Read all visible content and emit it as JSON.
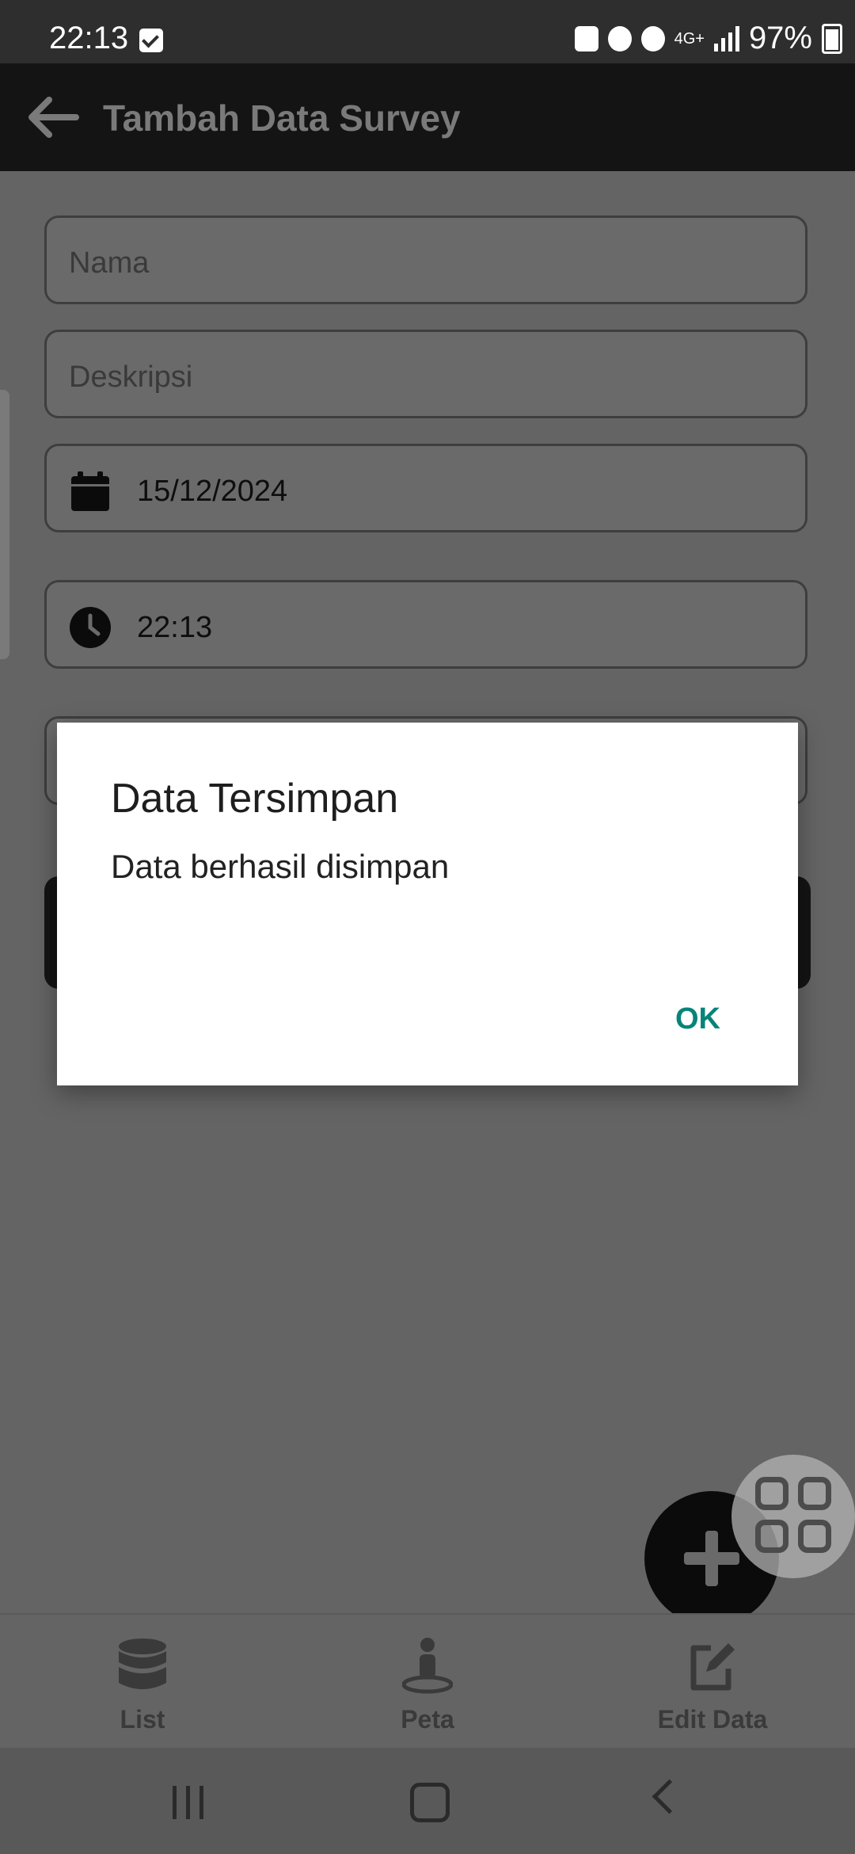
{
  "status_bar": {
    "time": "22:13",
    "network": "4G+",
    "battery": "97%"
  },
  "app_bar": {
    "title": "Tambah Data Survey"
  },
  "form": {
    "nama_placeholder": "Nama",
    "deskripsi_placeholder": "Deskripsi",
    "date_value": "15/12/2024",
    "time_value": "22:13"
  },
  "dialog": {
    "title": "Data Tersimpan",
    "message": "Data berhasil disimpan",
    "ok_label": "OK"
  },
  "bottom_nav": {
    "items": [
      {
        "label": "List",
        "icon": "database-icon"
      },
      {
        "label": "Peta",
        "icon": "person-pin-icon"
      },
      {
        "label": "Edit Data",
        "icon": "edit-icon"
      }
    ]
  },
  "colors": {
    "accent": "#06847a",
    "scrim": "#646464",
    "appbar": "#141414"
  }
}
